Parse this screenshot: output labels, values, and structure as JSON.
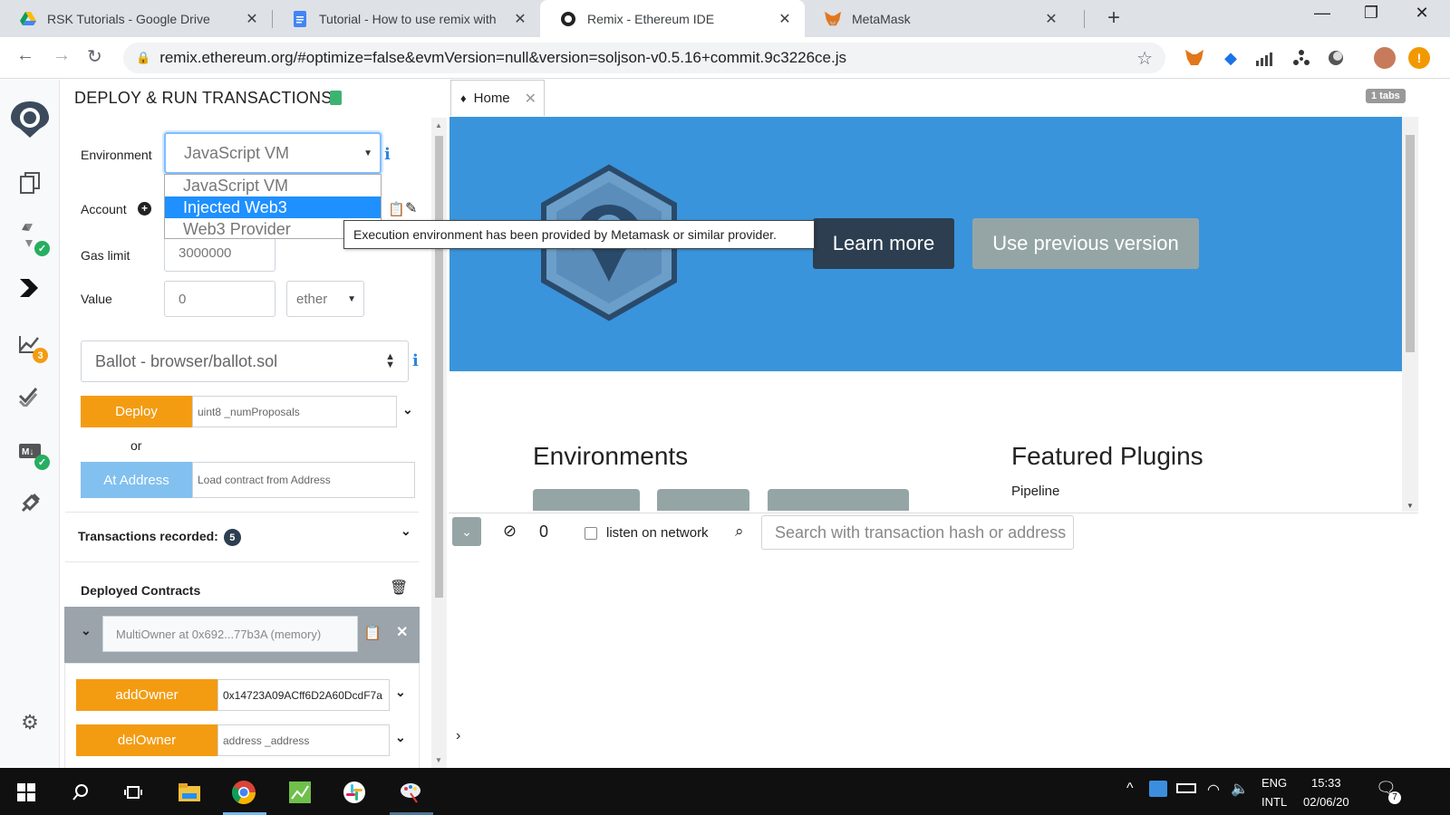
{
  "browser": {
    "tabs": [
      {
        "title": "RSK Tutorials - Google Drive",
        "icon": "google-drive-icon"
      },
      {
        "title": "Tutorial - How to use remix with",
        "icon": "google-docs-icon"
      },
      {
        "title": "Remix - Ethereum IDE",
        "icon": "remix-icon"
      },
      {
        "title": "MetaMask",
        "icon": "metamask-fox-icon"
      }
    ],
    "url": "remix.ethereum.org/#optimize=false&evmVersion=null&version=soljson-v0.5.16+commit.9c3226ce.js"
  },
  "icon_panel": {
    "items": [
      "file-explorer-icon",
      "solidity-compiler-icon",
      "deploy-run-icon",
      "analysis-icon",
      "testing-icon",
      "markdown-icon",
      "plugin-manager-icon",
      "settings-icon"
    ],
    "analysis_badge": "3"
  },
  "deploy_panel": {
    "title": "DEPLOY & RUN TRANSACTIONS",
    "environment_label": "Environment",
    "environment_value": "JavaScript VM",
    "environment_options": [
      "JavaScript VM",
      "Injected Web3",
      "Web3 Provider"
    ],
    "environment_selected_index": 1,
    "account_label": "Account",
    "gas_limit_label": "Gas limit",
    "gas_limit_value": "3000000",
    "value_label": "Value",
    "value_amount": "0",
    "value_unit": "ether",
    "contract_select": "Ballot - browser/ballot.sol",
    "deploy_label": "Deploy",
    "deploy_param_placeholder": "uint8 _numProposals",
    "or_label": "or",
    "at_address_label": "At Address",
    "at_address_placeholder": "Load contract from Address",
    "transactions_recorded_label": "Transactions recorded:",
    "transactions_recorded_count": "5",
    "deployed_contracts_label": "Deployed Contracts",
    "deployed_instance": "MultiOwner at 0x692...77b3A (memory)",
    "functions": [
      {
        "name": "addOwner",
        "param": "0x14723A09ACff6D2A60DcdF7a"
      },
      {
        "name": "delOwner",
        "param": "address _address"
      }
    ]
  },
  "tooltip": "Execution environment has been provided by Metamask or similar provider.",
  "main": {
    "editor_tab": "Home",
    "tabs_count": "1 tabs",
    "learn_more": "Learn more",
    "use_previous": "Use previous version",
    "environments_title": "Environments",
    "featured_plugins_title": "Featured Plugins",
    "featured_plugin_first": "Pipeline",
    "terminal": {
      "pending_count": "0",
      "listen_label": "listen on network",
      "search_placeholder": "Search with transaction hash or address"
    }
  },
  "taskbar": {
    "lang_top": "ENG",
    "lang_bottom": "INTL",
    "time": "15:33",
    "date": "02/06/20",
    "notification_count": "7"
  },
  "colors": {
    "banner_blue": "#3a94db",
    "accent_orange": "#f39c12",
    "dark_button": "#2c3e50",
    "selected_option": "#1e90ff"
  }
}
